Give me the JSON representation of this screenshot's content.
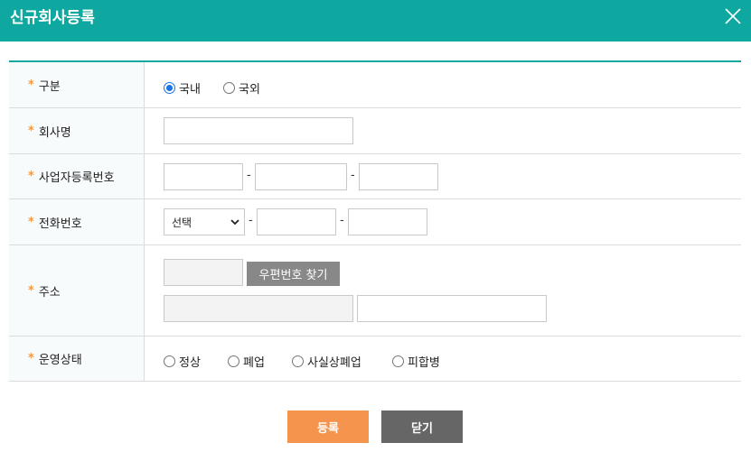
{
  "dialog": {
    "title": "신규회사등록"
  },
  "colors": {
    "accent": "#0fa8a0",
    "required": "#f39a45",
    "primary_button": "#f5954d",
    "secondary_button": "#666666"
  },
  "form": {
    "type": {
      "label": "구분",
      "options": [
        {
          "label": "국내",
          "selected": true
        },
        {
          "label": "국외",
          "selected": false
        }
      ]
    },
    "company_name": {
      "label": "회사명",
      "value": ""
    },
    "business_number": {
      "label": "사업자등록번호",
      "sep": "-"
    },
    "phone": {
      "label": "전화번호",
      "select_value": "선택",
      "sep": "-"
    },
    "address": {
      "label": "주소",
      "postcode_button": "우편번호 찾기"
    },
    "status": {
      "label": "운영상태",
      "options": [
        {
          "label": "정상"
        },
        {
          "label": "폐업"
        },
        {
          "label": "사실상폐업"
        },
        {
          "label": "피합병"
        }
      ]
    }
  },
  "actions": {
    "register": "등록",
    "close": "닫기"
  },
  "required_mark": "*"
}
